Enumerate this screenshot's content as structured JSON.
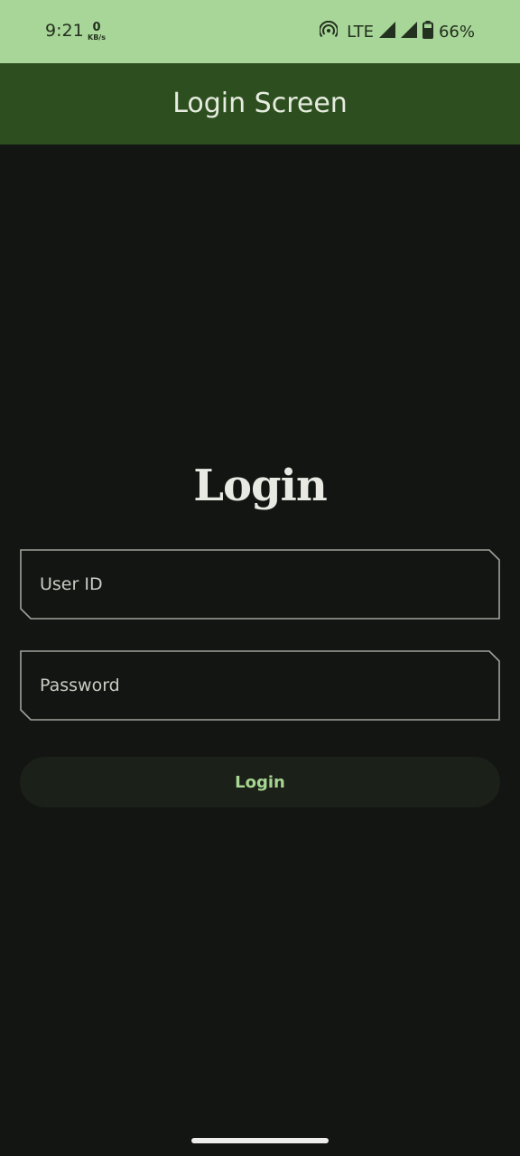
{
  "status_bar": {
    "time": "9:21",
    "net_speed_value": "0",
    "net_speed_unit": "KB/s",
    "network_type": "LTE",
    "battery": "66%",
    "icons": [
      "hotspot-icon",
      "signal-icon",
      "signal-icon",
      "battery-icon"
    ]
  },
  "app_bar": {
    "title": "Login Screen"
  },
  "login_form": {
    "heading": "Login",
    "user_id_placeholder": "User ID",
    "password_placeholder": "Password",
    "login_button_label": "Login"
  },
  "colors": {
    "status_bar_bg": "#a8d698",
    "app_bar_bg": "#2d4f1f",
    "page_bg": "#131512",
    "button_text": "#a6d691",
    "field_border": "#9ea39a"
  }
}
